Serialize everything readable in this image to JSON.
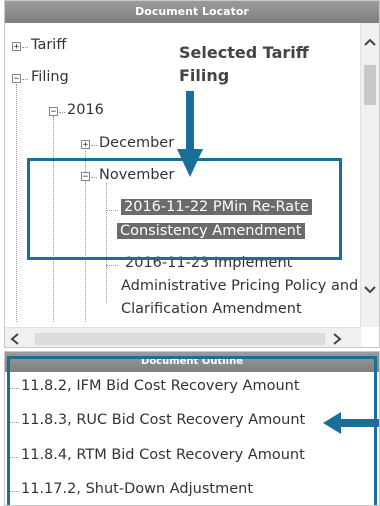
{
  "locator": {
    "title": "Document Locator",
    "annotation_line1": "Selected Tariff",
    "annotation_line2": "Filing",
    "tree": {
      "tariff": "Tariff",
      "filing": "Filing",
      "year": "2016",
      "december": "December",
      "november": "November",
      "selected_line1": "2016-11-22 PMin Re-Rate",
      "selected_line2": "Consistency Amendment",
      "next_line1": "2016-11-23 Implement",
      "next_line2": "Administrative Pricing Policy and",
      "next_line3": "Clarification Amendment"
    }
  },
  "outline": {
    "title": "Document Outline",
    "items": [
      "11.8.2, IFM Bid Cost Recovery Amount",
      "11.8.3, RUC Bid Cost Recovery Amount",
      "11.8.4, RTM Bid Cost Recovery Amount",
      "11.17.2, Shut-Down Adjustment"
    ]
  },
  "colors": {
    "accent": "#1a6f9a",
    "selection": "#6b6b6b",
    "header": "#8a8a8a"
  },
  "icons": [
    "plus-expander-icon",
    "minus-expander-icon",
    "arrow-down-icon",
    "arrow-left-icon",
    "chevron-up-icon",
    "chevron-down-icon",
    "chevron-left-icon",
    "chevron-right-icon"
  ]
}
